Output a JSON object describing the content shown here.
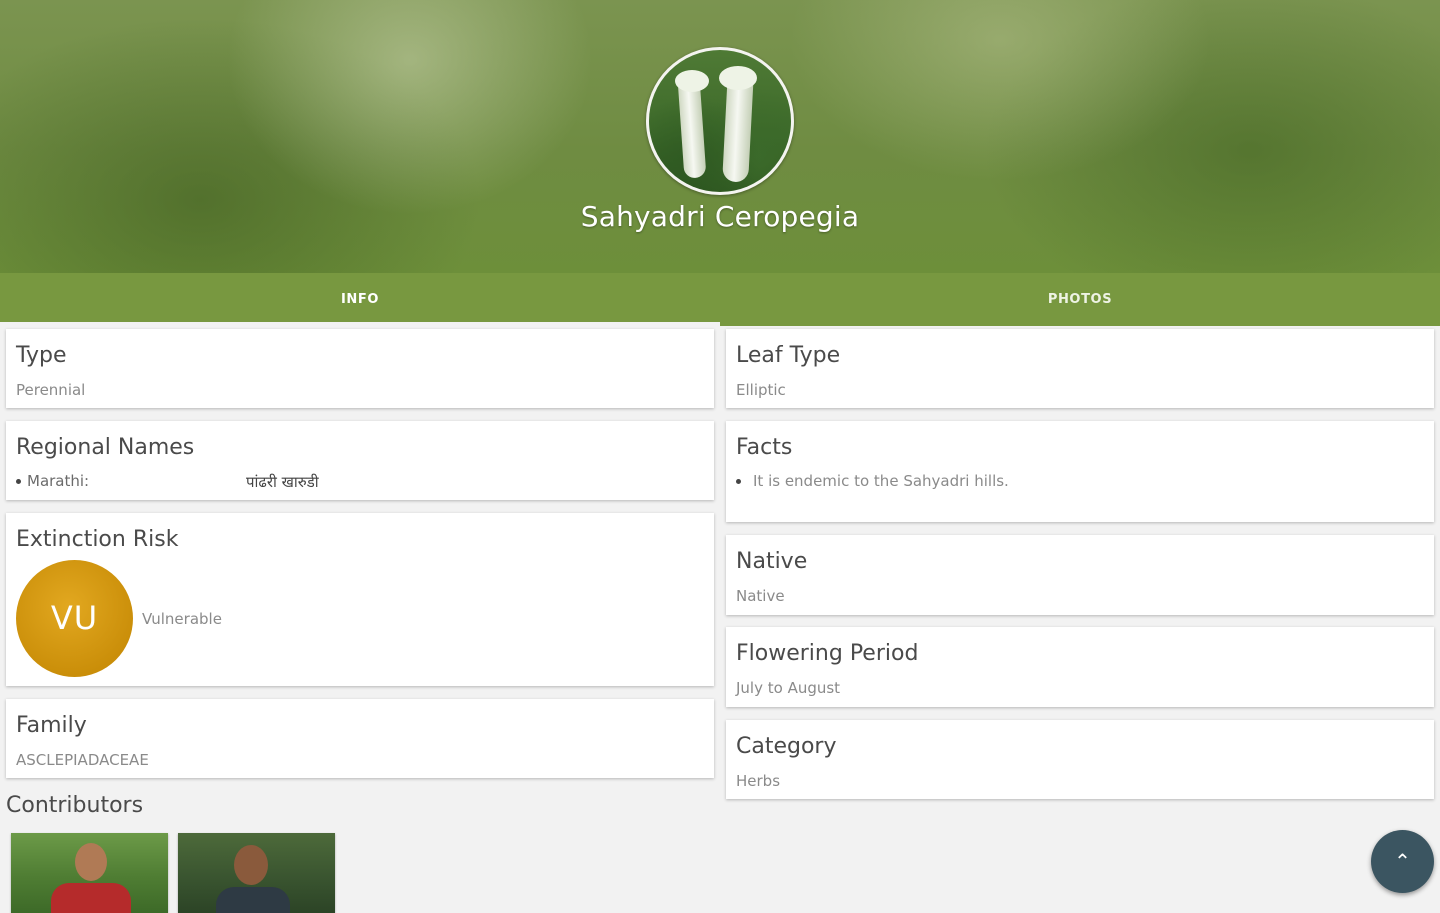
{
  "header": {
    "plant_name": "Sahyadri Ceropegia"
  },
  "tabs": [
    {
      "label": "INFO",
      "selected": true
    },
    {
      "label": "PHOTOS",
      "selected": false
    }
  ],
  "left_cards": {
    "type": {
      "title": "Type",
      "value": "Perennial"
    },
    "regional_names": {
      "title": "Regional Names",
      "entries": [
        {
          "language": "Marathi:",
          "name": "पांढरी खारुडी"
        }
      ]
    },
    "extinction_risk": {
      "title": "Extinction Risk",
      "code": "VU",
      "status": "Vulnerable",
      "color": "#d49a12"
    },
    "family": {
      "title": "Family",
      "value": "ASCLEPIADACEAE"
    }
  },
  "right_cards": {
    "leaf_type": {
      "title": "Leaf Type",
      "value": "Elliptic"
    },
    "facts": {
      "title": "Facts",
      "items": [
        "It is endemic to the Sahyadri hills."
      ]
    },
    "native": {
      "title": "Native",
      "value": "Native"
    },
    "flowering_period": {
      "title": "Flowering Period",
      "value": "July to August"
    },
    "category": {
      "title": "Category",
      "value": "Herbs"
    }
  },
  "contributors": {
    "title": "Contributors"
  },
  "fab": {
    "icon": "chevron-up-icon",
    "glyph": "⌃"
  },
  "colors": {
    "accent": "#789840",
    "risk": "#d49a12",
    "fab": "#3b5561"
  }
}
